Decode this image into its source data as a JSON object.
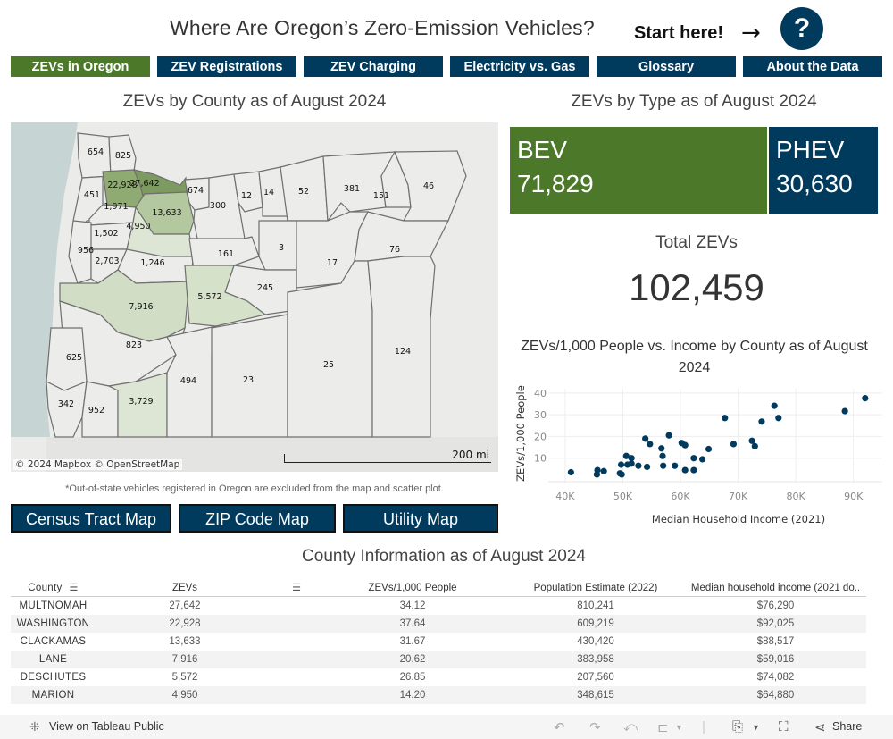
{
  "header": {
    "title": "Where Are Oregon’s Zero-Emission Vehicles?",
    "start_here": "Start here!",
    "arrow_icon": "→",
    "help_icon": "?"
  },
  "tabs": [
    {
      "label": "ZEVs in Oregon",
      "active": true
    },
    {
      "label": "ZEV Registrations",
      "active": false
    },
    {
      "label": "ZEV Charging",
      "active": false
    },
    {
      "label": "Electricity vs. Gas",
      "active": false
    },
    {
      "label": "Glossary",
      "active": false
    },
    {
      "label": "About the Data",
      "active": false
    }
  ],
  "colors": {
    "brand_navy": "#003a5c",
    "brand_green": "#4c782a"
  },
  "map": {
    "title": "ZEVs by County as of August 2024",
    "attribution": "© 2024 Mapbox  © OpenStreetMap",
    "scale_label": "200 mi",
    "counties": [
      {
        "label": "654"
      },
      {
        "label": "825"
      },
      {
        "label": "22,928"
      },
      {
        "label": "27,642"
      },
      {
        "label": "674"
      },
      {
        "label": "12"
      },
      {
        "label": "14"
      },
      {
        "label": "52"
      },
      {
        "label": "381"
      },
      {
        "label": "151"
      },
      {
        "label": "46"
      },
      {
        "label": "451"
      },
      {
        "label": "1,971"
      },
      {
        "label": "13,633"
      },
      {
        "label": "300"
      },
      {
        "label": "1,502"
      },
      {
        "label": "4,950"
      },
      {
        "label": "956"
      },
      {
        "label": "2,703"
      },
      {
        "label": "1,246"
      },
      {
        "label": "161"
      },
      {
        "label": "3"
      },
      {
        "label": "17"
      },
      {
        "label": "76"
      },
      {
        "label": "7,916"
      },
      {
        "label": "5,572"
      },
      {
        "label": "245"
      },
      {
        "label": "823"
      },
      {
        "label": "625"
      },
      {
        "label": "494"
      },
      {
        "label": "23"
      },
      {
        "label": "25"
      },
      {
        "label": "124"
      },
      {
        "label": "342"
      },
      {
        "label": "952"
      },
      {
        "label": "3,729"
      }
    ],
    "footnote": "*Out-of-state vehicles registered in Oregon are excluded from the map and scatter plot.",
    "buttons": [
      "Census Tract Map",
      "ZIP Code Map",
      "Utility Map"
    ]
  },
  "by_type": {
    "title": "ZEVs by Type as of August 2024",
    "types": [
      {
        "label": "BEV",
        "value": "71,829",
        "count": 71829
      },
      {
        "label": "PHEV",
        "value": "30,630",
        "count": 30630
      }
    ],
    "total_label": "Total ZEVs",
    "total_value": "102,459"
  },
  "chart_data": {
    "type": "scatter",
    "title": "ZEVs/1,000 People vs. Income by County as of August 2024",
    "xlabel": "Median Household Income (2021)",
    "ylabel": "ZEVs/1,000 People",
    "xlim": [
      38000,
      95000
    ],
    "ylim": [
      0,
      42
    ],
    "x_ticks": [
      {
        "v": 40000,
        "label": "40K"
      },
      {
        "v": 50000,
        "label": "50K"
      },
      {
        "v": 60000,
        "label": "60K"
      },
      {
        "v": 70000,
        "label": "70K"
      },
      {
        "v": 80000,
        "label": "80K"
      },
      {
        "v": 90000,
        "label": "90K"
      }
    ],
    "y_ticks": [
      {
        "v": 10,
        "label": "10"
      },
      {
        "v": 20,
        "label": "20"
      },
      {
        "v": 30,
        "label": "30"
      },
      {
        "v": 40,
        "label": "40"
      }
    ],
    "grid": true,
    "points": [
      {
        "x": 41000,
        "y": 3.5
      },
      {
        "x": 45500,
        "y": 2.5
      },
      {
        "x": 45600,
        "y": 4.5
      },
      {
        "x": 46700,
        "y": 4
      },
      {
        "x": 49500,
        "y": 3
      },
      {
        "x": 49800,
        "y": 2.5
      },
      {
        "x": 49700,
        "y": 7
      },
      {
        "x": 50800,
        "y": 7
      },
      {
        "x": 50600,
        "y": 11
      },
      {
        "x": 51500,
        "y": 10
      },
      {
        "x": 51500,
        "y": 7.5
      },
      {
        "x": 52700,
        "y": 6.5
      },
      {
        "x": 54200,
        "y": 6
      },
      {
        "x": 53900,
        "y": 19
      },
      {
        "x": 54700,
        "y": 16.5
      },
      {
        "x": 56700,
        "y": 14.5
      },
      {
        "x": 56900,
        "y": 11
      },
      {
        "x": 57000,
        "y": 6.5
      },
      {
        "x": 58000,
        "y": 20.5
      },
      {
        "x": 59016,
        "y": 6.5
      },
      {
        "x": 60200,
        "y": 17
      },
      {
        "x": 60800,
        "y": 16
      },
      {
        "x": 60800,
        "y": 4.5
      },
      {
        "x": 62300,
        "y": 4.5
      },
      {
        "x": 62300,
        "y": 10
      },
      {
        "x": 63800,
        "y": 9.5
      },
      {
        "x": 64880,
        "y": 14.2
      },
      {
        "x": 67700,
        "y": 28.5
      },
      {
        "x": 69200,
        "y": 16.5
      },
      {
        "x": 72400,
        "y": 18
      },
      {
        "x": 72900,
        "y": 15.5
      },
      {
        "x": 74082,
        "y": 26.85
      },
      {
        "x": 76290,
        "y": 34.12
      },
      {
        "x": 77000,
        "y": 28.5
      },
      {
        "x": 88517,
        "y": 31.67
      },
      {
        "x": 92025,
        "y": 37.64
      }
    ]
  },
  "table": {
    "title": "County Information as of August 2024",
    "columns": [
      "County",
      "ZEVs",
      "ZEVs/1,000 People",
      "Population Estimate (2022)",
      "Median household income (2021 do.."
    ],
    "sort_icon": "sort-icon",
    "rows": [
      [
        "MULTNOMAH",
        "27,642",
        "34.12",
        "810,241",
        "$76,290"
      ],
      [
        "WASHINGTON",
        "22,928",
        "37.64",
        "609,219",
        "$92,025"
      ],
      [
        "CLACKAMAS",
        "13,633",
        "31.67",
        "430,420",
        "$88,517"
      ],
      [
        "LANE",
        "7,916",
        "20.62",
        "383,958",
        "$59,016"
      ],
      [
        "DESCHUTES",
        "5,572",
        "26.85",
        "207,560",
        "$74,082"
      ],
      [
        "MARION",
        "4,950",
        "14.20",
        "348,615",
        "$64,880"
      ]
    ]
  },
  "toolbar": {
    "view_on_label": "View on Tableau Public",
    "share_label": "Share"
  }
}
